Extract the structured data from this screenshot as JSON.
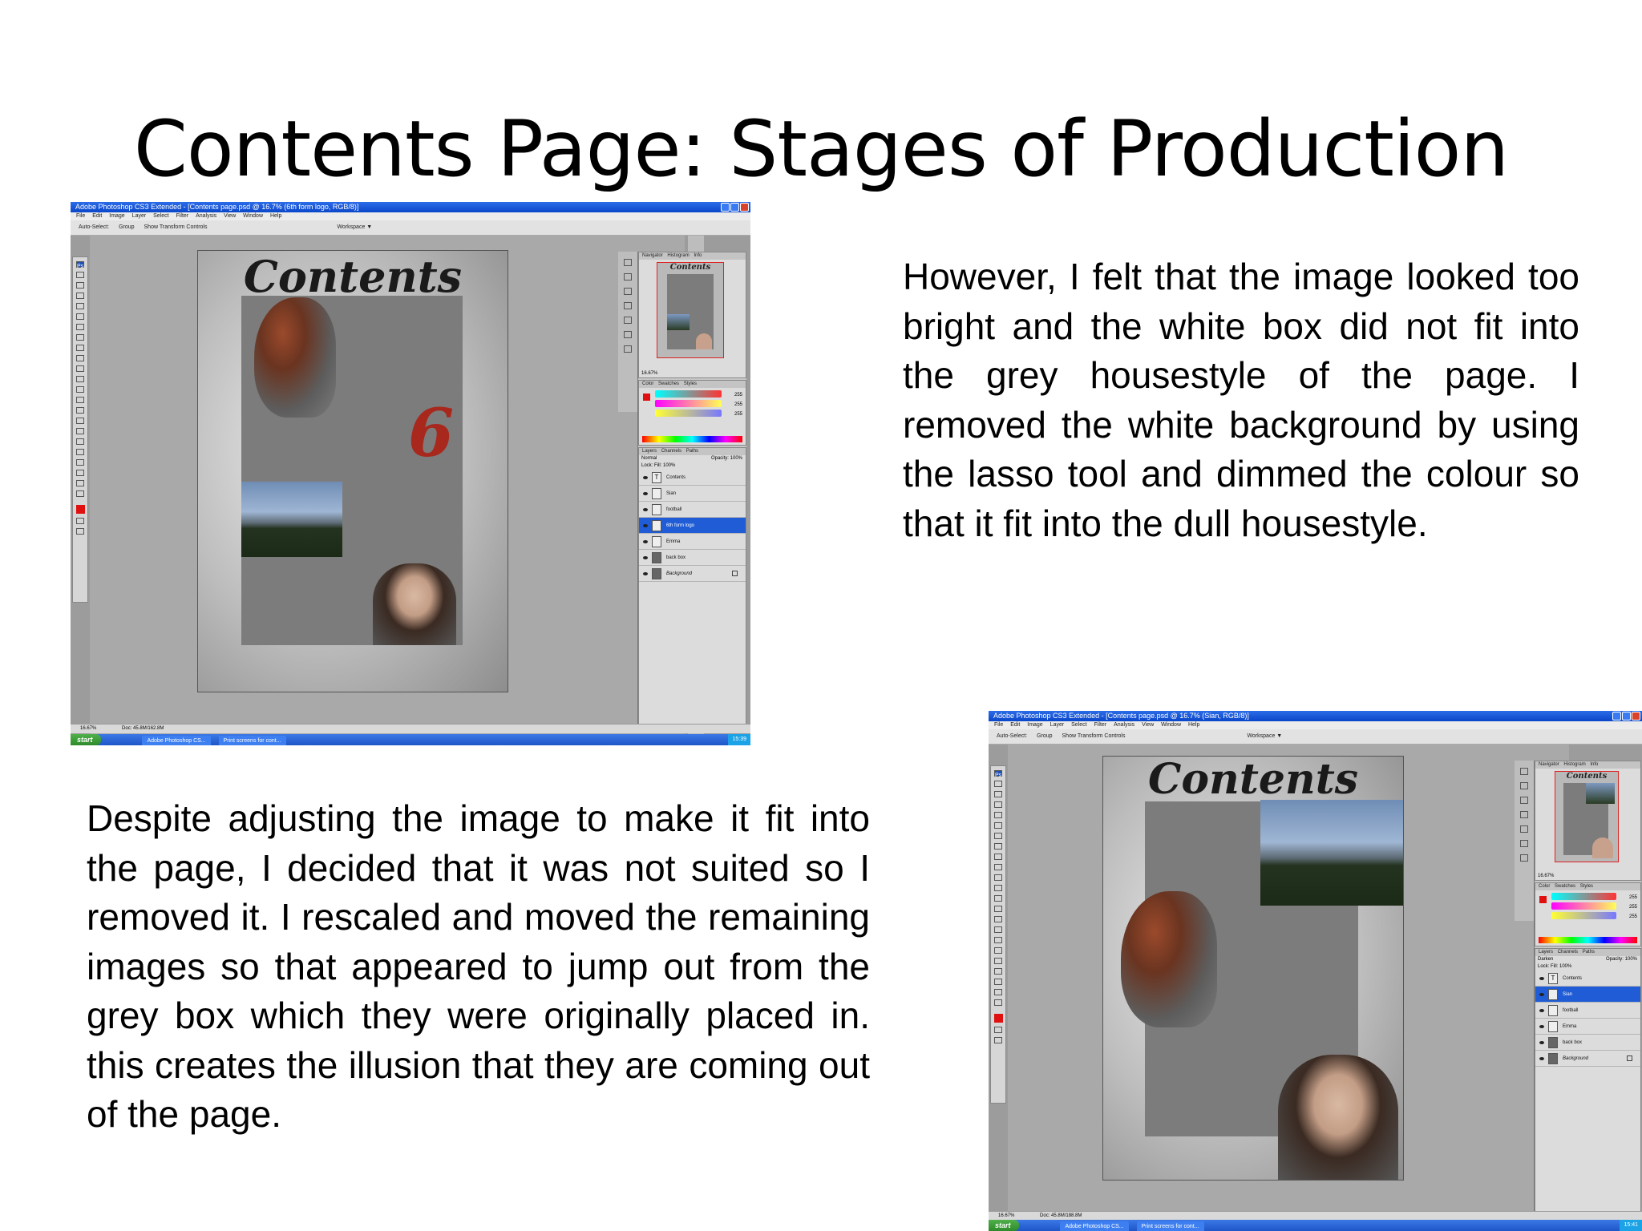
{
  "slide": {
    "title": "Contents Page: Stages of Production",
    "paragraph_top": "However, I felt that the image looked too bright and the white box did not fit into the grey housestyle of the page. I removed the white background by using the lasso tool and dimmed the colour so that it fit into the dull housestyle.",
    "paragraph_bottom": "Despite adjusting the image to make it fit into the page, I decided that it was not suited so I removed it. I rescaled and moved the remaining images so that appeared to jump out from the grey box which they were originally placed in. this creates the illusion that they are coming out of the page."
  },
  "screenshot1": {
    "window_title": "Adobe Photoshop CS3 Extended - [Contents page.psd @ 16.7% (6th form logo, RGB/8)]",
    "menu": [
      "File",
      "Edit",
      "Image",
      "Layer",
      "Select",
      "Filter",
      "Analysis",
      "View",
      "Window",
      "Help"
    ],
    "options": {
      "auto_select": "Auto-Select:",
      "group": "Group",
      "transform": "Show Transform Controls",
      "workspace": "Workspace ▼"
    },
    "doc_heading": "Contents",
    "logo_glyph": "6",
    "panel_tabs_nav": [
      "Navigator",
      "Histogram",
      "Info"
    ],
    "panel_tabs_color": [
      "Color",
      "Swatches",
      "Styles"
    ],
    "panel_tabs_layers": [
      "Layers",
      "Channels",
      "Paths"
    ],
    "zoom": "16.67%",
    "blend_mode": "Normal",
    "opacity": "Opacity: 100%",
    "lock_fill": "Lock:          Fill: 100%",
    "color_values": [
      "255",
      "255",
      "255"
    ],
    "layers": [
      {
        "name": "Contents",
        "selected": false
      },
      {
        "name": "Sian",
        "selected": false
      },
      {
        "name": "football",
        "selected": false
      },
      {
        "name": "6th form logo",
        "selected": true
      },
      {
        "name": "Emma",
        "selected": false
      },
      {
        "name": "back box",
        "selected": false
      },
      {
        "name": "Background",
        "selected": false
      }
    ],
    "status": {
      "zoom": "16.67%",
      "doc": "Doc: 45.8M/162.8M"
    },
    "taskbar": {
      "start": "start",
      "items": [
        "Adobe Photoshop CS...",
        "Print screens for cont..."
      ],
      "clock": "15:39"
    }
  },
  "screenshot2": {
    "window_title": "Adobe Photoshop CS3 Extended - [Contents page.psd @ 16.7% (Sian, RGB/8)]",
    "menu": [
      "File",
      "Edit",
      "Image",
      "Layer",
      "Select",
      "Filter",
      "Analysis",
      "View",
      "Window",
      "Help"
    ],
    "options": {
      "auto_select": "Auto-Select:",
      "group": "Group",
      "transform": "Show Transform Controls",
      "workspace": "Workspace ▼"
    },
    "doc_heading": "Contents",
    "panel_tabs_nav": [
      "Navigator",
      "Histogram",
      "Info"
    ],
    "panel_tabs_color": [
      "Color",
      "Swatches",
      "Styles"
    ],
    "panel_tabs_layers": [
      "Layers",
      "Channels",
      "Paths"
    ],
    "zoom": "16.67%",
    "blend_mode": "Darken",
    "opacity": "Opacity: 100%",
    "lock_fill": "Lock:          Fill: 100%",
    "color_values": [
      "255",
      "255",
      "255"
    ],
    "layers": [
      {
        "name": "Contents",
        "selected": false
      },
      {
        "name": "Sian",
        "selected": true
      },
      {
        "name": "football",
        "selected": false
      },
      {
        "name": "Emma",
        "selected": false
      },
      {
        "name": "back box",
        "selected": false
      },
      {
        "name": "Background",
        "selected": false
      }
    ],
    "status": {
      "zoom": "16.67%",
      "doc": "Doc: 45.8M/188.8M"
    },
    "taskbar": {
      "start": "start",
      "items": [
        "Adobe Photoshop CS...",
        "Print screens for cont..."
      ],
      "clock": "15:41"
    }
  }
}
